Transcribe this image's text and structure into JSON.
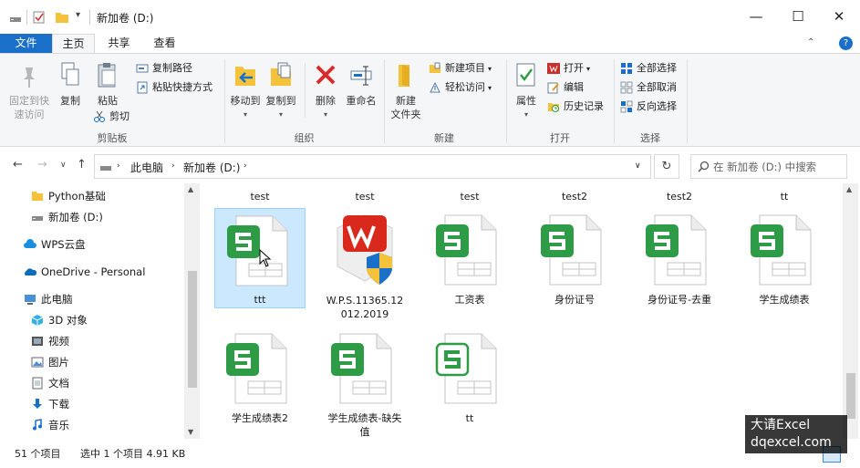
{
  "window": {
    "title": "新加卷 (D:)"
  },
  "tabs": [
    {
      "label": "文件"
    },
    {
      "label": "主页"
    },
    {
      "label": "共享"
    },
    {
      "label": "查看"
    }
  ],
  "ribbon": {
    "clipboard": {
      "pin": "固定到快\n速访问",
      "copy": "复制",
      "paste": "粘贴",
      "copy_path": "复制路径",
      "paste_shortcut": "粘贴快捷方式",
      "cut": "剪切",
      "label": "剪贴板"
    },
    "organize": {
      "move_to": "移动到",
      "copy_to": "复制到",
      "delete": "删除",
      "rename": "重命名",
      "label": "组织"
    },
    "new": {
      "new_folder": "新建\n文件夹",
      "new_item": "新建项目",
      "easy_access": "轻松访问",
      "label": "新建"
    },
    "open": {
      "properties": "属性",
      "open": "打开",
      "edit": "编辑",
      "history": "历史记录",
      "label": "打开"
    },
    "select": {
      "select_all": "全部选择",
      "select_none": "全部取消",
      "invert": "反向选择",
      "label": "选择"
    }
  },
  "address": {
    "crumbs": [
      "此电脑",
      "新加卷 (D:)"
    ],
    "search_placeholder": "在 新加卷 (D:) 中搜索"
  },
  "nav": [
    {
      "label": "Python基础",
      "icon": "folder-icon"
    },
    {
      "label": "新加卷 (D:)",
      "icon": "drive-icon"
    },
    {
      "label": "WPS云盘",
      "icon": "cloud-icon"
    },
    {
      "label": "OneDrive - Personal",
      "icon": "onedrive-icon"
    },
    {
      "label": "此电脑",
      "icon": "computer-icon"
    },
    {
      "label": "3D 对象",
      "icon": "cube-icon"
    },
    {
      "label": "视频",
      "icon": "video-icon"
    },
    {
      "label": "图片",
      "icon": "picture-icon"
    },
    {
      "label": "文档",
      "icon": "document-icon"
    },
    {
      "label": "下载",
      "icon": "download-icon"
    },
    {
      "label": "音乐",
      "icon": "music-icon"
    }
  ],
  "files": {
    "header_row": [
      "test",
      "test",
      "test",
      "test2",
      "test2",
      "tt"
    ],
    "items": [
      {
        "name": "ttt",
        "type": "sheet",
        "selected": true
      },
      {
        "name": "W.P.S.11365.12\n012.2019",
        "type": "installer"
      },
      {
        "name": "工资表",
        "type": "sheet"
      },
      {
        "name": "身份证号",
        "type": "sheet"
      },
      {
        "name": "身份证号-去重",
        "type": "sheet"
      },
      {
        "name": "学生成绩表",
        "type": "sheet"
      },
      {
        "name": "学生成绩表2",
        "type": "sheet"
      },
      {
        "name": "学生成绩表-缺失\n值",
        "type": "sheet"
      },
      {
        "name": "tt",
        "type": "sheet-outline"
      }
    ]
  },
  "status": {
    "count": "51 个项目",
    "selection": "选中 1 个项目  4.91 KB"
  },
  "watermark": {
    "line1": "大请Excel",
    "line2": "dqexcel.com"
  },
  "colors": {
    "accent": "#1a6fc8",
    "sheet_green": "#2e9b46",
    "selected": "#cce8ff"
  }
}
